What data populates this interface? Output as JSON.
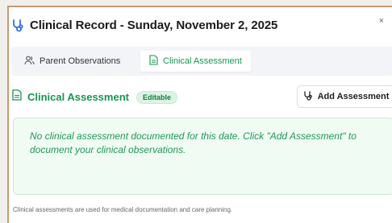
{
  "dialog": {
    "title": "Clinical Record - Sunday, November 2, 2025",
    "close_glyph": "×"
  },
  "tabs": [
    {
      "label": "Parent Observations",
      "icon": "people-icon",
      "active": false
    },
    {
      "label": "Clinical Assessment",
      "icon": "document-icon",
      "active": true
    }
  ],
  "section": {
    "title": "Clinical Assessment",
    "badge": "Editable",
    "add_button_label": "Add Assessment"
  },
  "empty_state": {
    "message": "No clinical assessment documented for this date. Click \"Add Assessment\" to document your clinical observations."
  },
  "footnote": "Clinical assessments are used for medical documentation and care planning.",
  "colors": {
    "accent_green": "#169650",
    "header_icon_blue": "#2f6fdc",
    "panel_green_bg": "#f0fbf3"
  }
}
